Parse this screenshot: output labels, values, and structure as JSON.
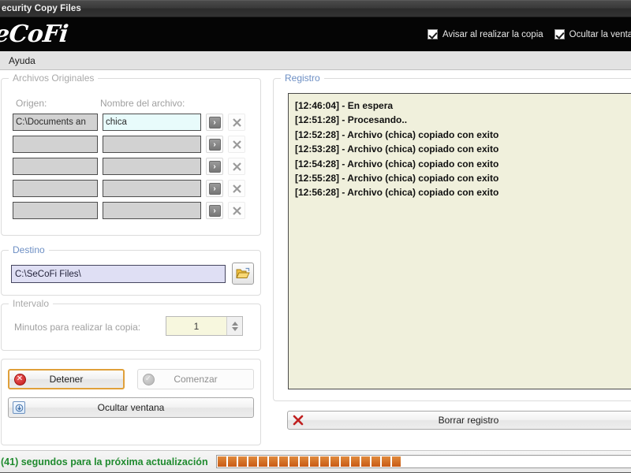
{
  "window": {
    "title": "ecurity Copy Files",
    "brand": "eCoFi"
  },
  "header": {
    "checkboxes": [
      {
        "label": "Avisar al realizar la copia",
        "checked": true
      },
      {
        "label": "Ocultar la ventana",
        "checked": true
      }
    ]
  },
  "menubar": {
    "items": [
      {
        "label": "Ayuda"
      }
    ]
  },
  "originales": {
    "legend": "Archivos Originales",
    "col_origen": "Origen:",
    "col_nombre": "Nombre del archivo:",
    "browse_glyph": "›",
    "rows": [
      {
        "origen": "C:\\Documents an",
        "nombre": "chica",
        "active": true
      },
      {
        "origen": "",
        "nombre": "",
        "active": false
      },
      {
        "origen": "",
        "nombre": "",
        "active": false
      },
      {
        "origen": "",
        "nombre": "",
        "active": false
      },
      {
        "origen": "",
        "nombre": "",
        "active": false
      }
    ]
  },
  "destino": {
    "legend": "Destino",
    "path": "C:\\SeCoFi Files\\",
    "browse_icon": "folder-open-icon"
  },
  "intervalo": {
    "legend": "Intervalo",
    "label": "Minutos para realizar la copia:",
    "value": "1"
  },
  "actions": {
    "detener": {
      "label": "Detener",
      "icon": "error-circle-icon",
      "glyph": "✕",
      "enabled": true
    },
    "comenzar": {
      "label": "Comenzar",
      "icon": "check-circle-icon",
      "glyph": "✓",
      "enabled": false
    },
    "ocultar": {
      "label": "Ocultar ventana",
      "icon": "minimize-to-tray-icon",
      "glyph": "↧"
    }
  },
  "registro": {
    "legend": "Registro",
    "lines": [
      "[12:46:04] - En espera",
      "[12:51:28] - Procesando..",
      "[12:52:28] - Archivo (chica) copiado con exito",
      "[12:53:28] - Archivo (chica) copiado con exito",
      "[12:54:28] - Archivo (chica) copiado con exito",
      "[12:55:28] - Archivo (chica) copiado con exito",
      "[12:56:28] - Archivo (chica) copiado con exito"
    ],
    "clear_button": {
      "label": "Borrar registro",
      "icon": "red-x-icon"
    }
  },
  "statusbar": {
    "text": "(41) segundos para la próxima actualización",
    "seconds_remaining": 41,
    "progress_segments": 18,
    "progress_percent": 36
  },
  "colors": {
    "brand_bar": "#050505",
    "log_background": "#f0f0dc",
    "status_text": "#1f8a2e",
    "progress_fill": "#c85a14",
    "focus_border": "#e0a03a",
    "destino_field": "#dfdff4",
    "legend_blue": "#6d8fc4"
  }
}
